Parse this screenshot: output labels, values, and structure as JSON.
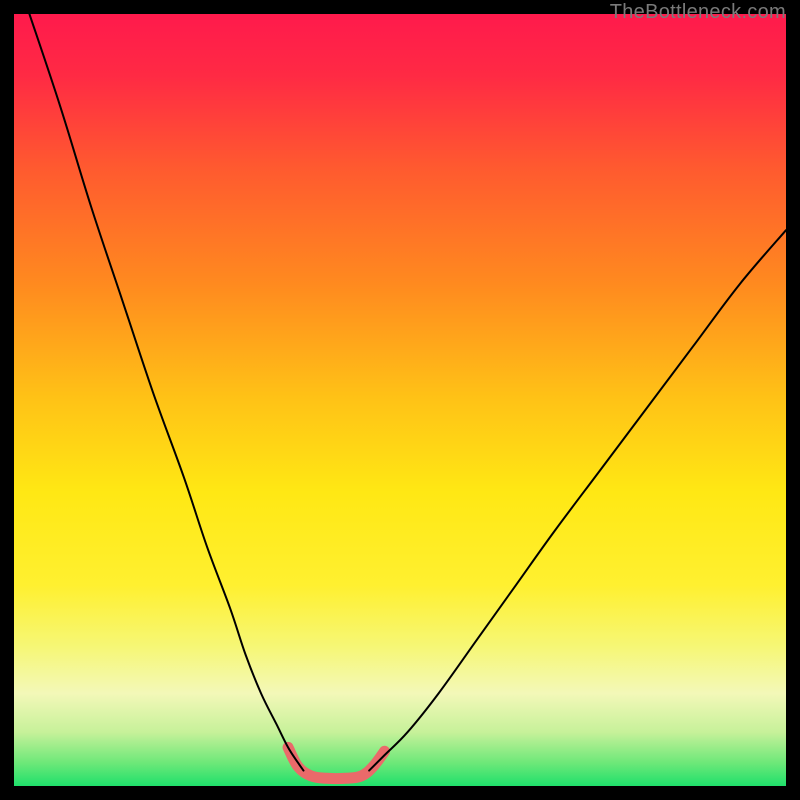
{
  "watermark": "TheBottleneck.com",
  "colors": {
    "frame": "#000000",
    "gradient_stops": [
      {
        "offset": 0.0,
        "color": "#ff1a4c"
      },
      {
        "offset": 0.08,
        "color": "#ff2a44"
      },
      {
        "offset": 0.2,
        "color": "#ff5a2f"
      },
      {
        "offset": 0.35,
        "color": "#ff8a1f"
      },
      {
        "offset": 0.5,
        "color": "#ffc316"
      },
      {
        "offset": 0.62,
        "color": "#ffe814"
      },
      {
        "offset": 0.74,
        "color": "#fff030"
      },
      {
        "offset": 0.82,
        "color": "#f6f776"
      },
      {
        "offset": 0.88,
        "color": "#f3f8b8"
      },
      {
        "offset": 0.93,
        "color": "#c7f19a"
      },
      {
        "offset": 0.97,
        "color": "#6de879"
      },
      {
        "offset": 1.0,
        "color": "#1fe06b"
      }
    ],
    "curve": "#000000",
    "bottom_highlight": "#ea6a6a"
  },
  "chart_data": {
    "type": "line",
    "title": "",
    "xlabel": "",
    "ylabel": "",
    "xlim": [
      0,
      100
    ],
    "ylim": [
      0,
      100
    ],
    "grid": false,
    "note": "Axis values estimated from position; chart has no labeled ticks. y=0 at bottom (green), y=100 at top (red). Two curves form a V with a flat-ish minimum near x≈37–46, plus a short salmon highlight segment near the minimum.",
    "series": [
      {
        "name": "left-branch",
        "x": [
          2.0,
          6.0,
          10.0,
          14.0,
          18.0,
          22.0,
          25.0,
          28.0,
          30.0,
          32.0,
          34.0,
          35.5,
          36.8,
          37.5
        ],
        "y": [
          100.0,
          88.0,
          75.0,
          63.0,
          51.0,
          40.0,
          31.0,
          23.0,
          17.0,
          12.0,
          8.0,
          5.0,
          3.0,
          2.0
        ]
      },
      {
        "name": "right-branch",
        "x": [
          46.0,
          48.0,
          51.0,
          55.0,
          60.0,
          65.0,
          70.0,
          76.0,
          82.0,
          88.0,
          94.0,
          100.0
        ],
        "y": [
          2.0,
          4.0,
          7.0,
          12.0,
          19.0,
          26.0,
          33.0,
          41.0,
          49.0,
          57.0,
          65.0,
          72.0
        ]
      },
      {
        "name": "bottom-highlight",
        "x": [
          35.5,
          36.8,
          38.5,
          40.5,
          43.0,
          45.0,
          46.5,
          48.0
        ],
        "y": [
          5.0,
          2.5,
          1.3,
          1.0,
          1.0,
          1.3,
          2.5,
          4.5
        ]
      }
    ]
  }
}
